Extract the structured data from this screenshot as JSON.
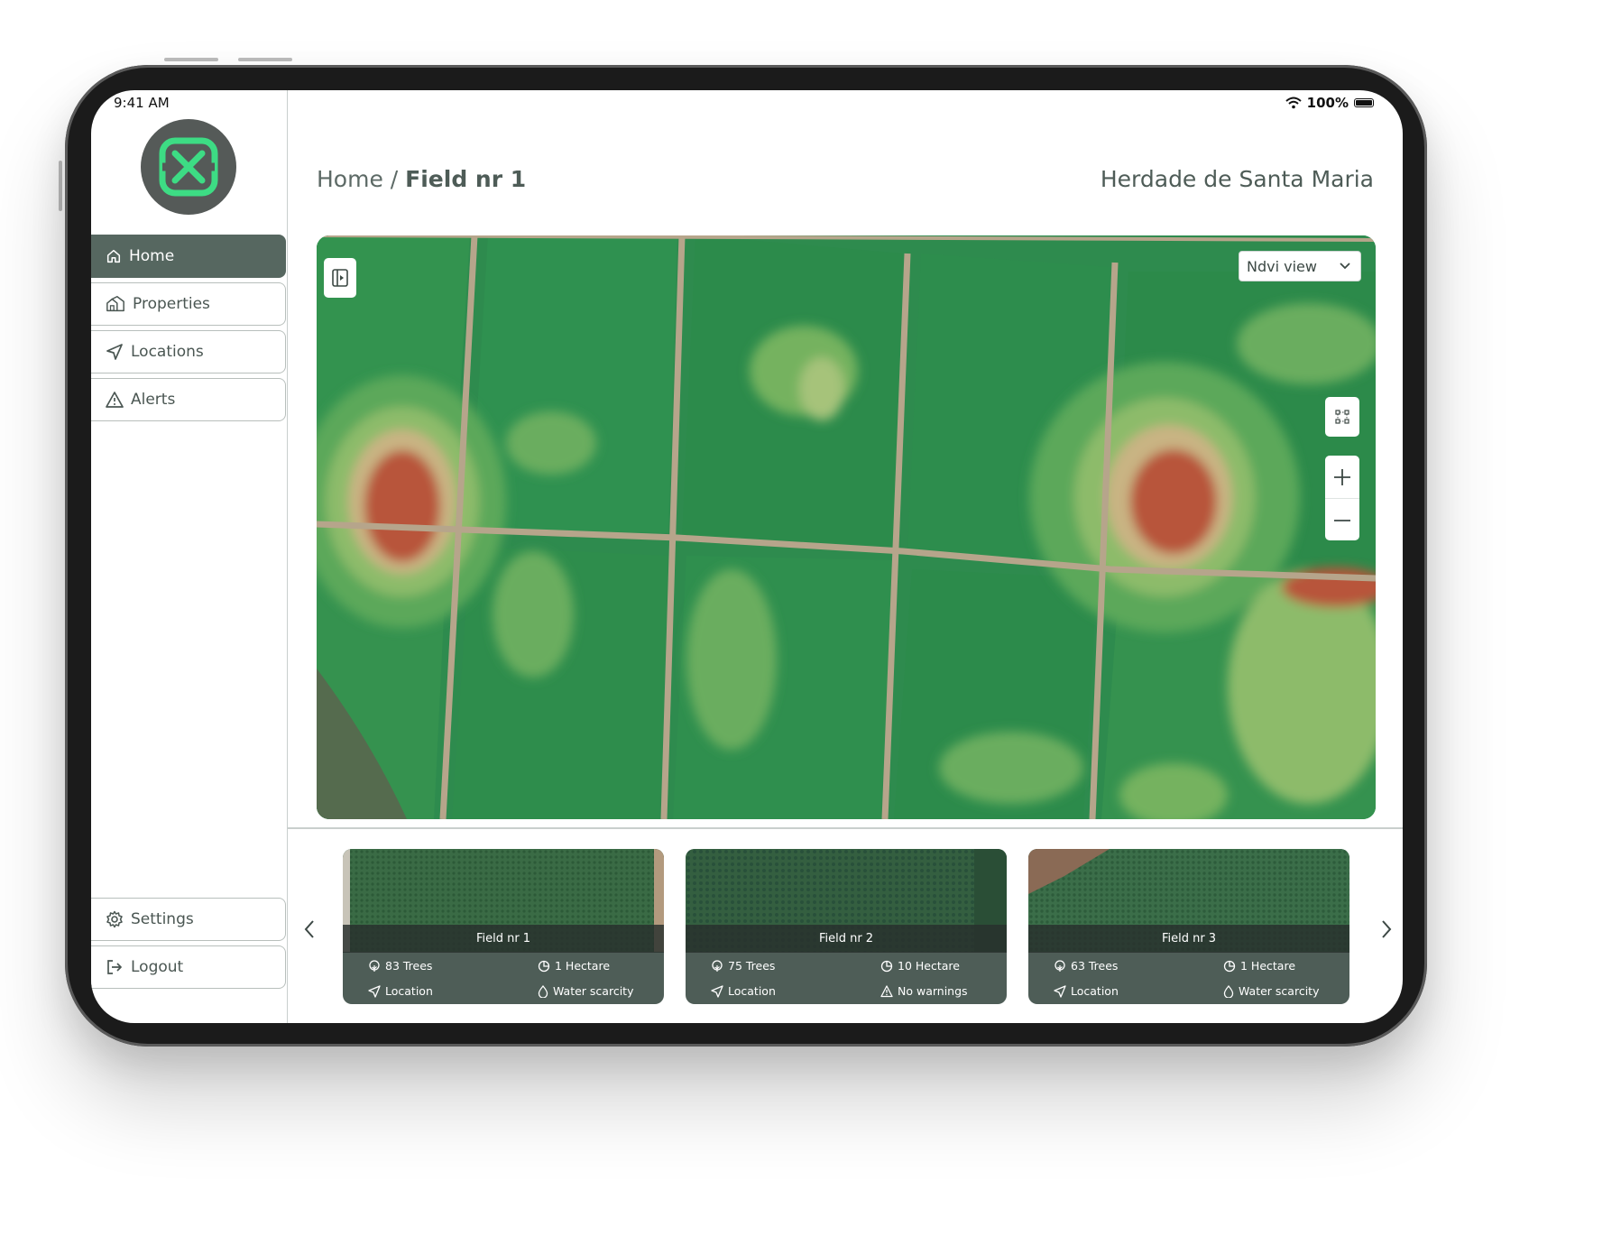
{
  "status_bar": {
    "time": "9:41 AM",
    "battery": "100%"
  },
  "sidebar": {
    "items": [
      {
        "label": "Home",
        "icon": "home-icon",
        "active": true
      },
      {
        "label": "Properties",
        "icon": "properties-icon"
      },
      {
        "label": "Locations",
        "icon": "location-arrow-icon"
      },
      {
        "label": "Alerts",
        "icon": "alert-triangle-icon"
      }
    ],
    "bottom_items": [
      {
        "label": "Settings",
        "icon": "gear-icon"
      },
      {
        "label": "Logout",
        "icon": "logout-icon"
      }
    ]
  },
  "header": {
    "breadcrumb_root": "Home",
    "breadcrumb_separator": " / ",
    "breadcrumb_current": "Field nr 1",
    "property_name": "Herdade de Santa Maria"
  },
  "map": {
    "view_select": {
      "selected": "Ndvi view"
    }
  },
  "fields": [
    {
      "name": "Field nr 1",
      "trees": "83 Trees",
      "area": "1 Hectare",
      "location": "Location",
      "status": "Water scarcity",
      "status_icon": "drop-icon"
    },
    {
      "name": "Field nr 2",
      "trees": "75 Trees",
      "area": "10 Hectare",
      "location": "Location",
      "status": "No warnings",
      "status_icon": "alert-triangle-icon"
    },
    {
      "name": "Field nr 3",
      "trees": "63 Trees",
      "area": "1 Hectare",
      "location": "Location",
      "status": "Water scarcity",
      "status_icon": "drop-icon"
    }
  ],
  "colors": {
    "sidebar_active": "#566760",
    "logo_bg": "#555a58",
    "logo_accent": "#3ddc84",
    "card_bg": "#4e5d57"
  }
}
